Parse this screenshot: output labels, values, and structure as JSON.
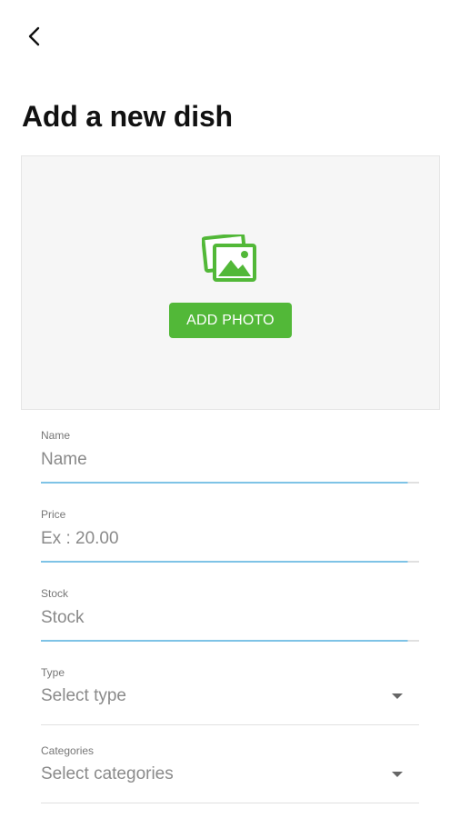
{
  "header": {
    "back_icon": "chevron-left-icon",
    "title": "Add a new dish"
  },
  "photo": {
    "icon": "image-gallery-icon",
    "button_label": "ADD PHOTO",
    "accent_color": "#52b838"
  },
  "form": {
    "name": {
      "label": "Name",
      "placeholder": "Name"
    },
    "price": {
      "label": "Price",
      "placeholder": "Ex : 20.00"
    },
    "stock": {
      "label": "Stock",
      "placeholder": "Stock"
    },
    "type": {
      "label": "Type",
      "value": "Select type",
      "icon": "dropdown-arrow-icon"
    },
    "categories": {
      "label": "Categories",
      "value": "Select categories",
      "icon": "dropdown-arrow-icon"
    }
  },
  "colors": {
    "focus_underline": "#7ec3e6",
    "default_underline": "#e0e0e0"
  }
}
